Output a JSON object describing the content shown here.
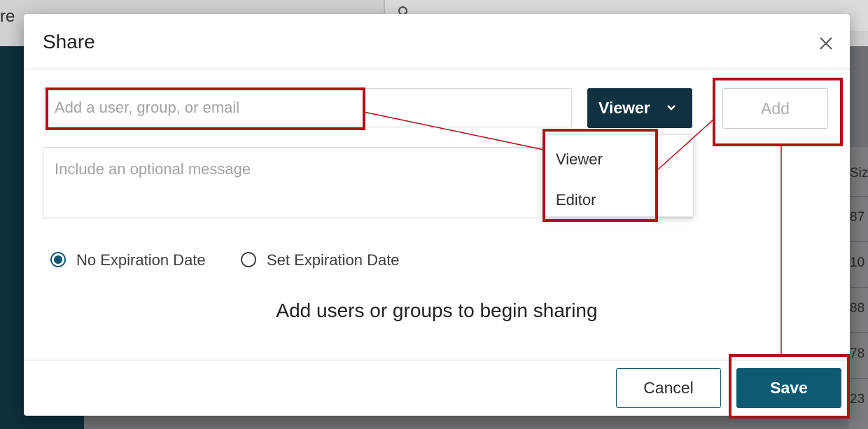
{
  "background": {
    "topbar_partial_text": "re",
    "table_partial_header": "Siz",
    "table_partial_cells": [
      "87",
      "10",
      "88",
      "78",
      "23"
    ]
  },
  "dialog": {
    "title": "Share",
    "user_input": {
      "placeholder": "Add a user, group, or email",
      "value": ""
    },
    "role_button": {
      "label": "Viewer"
    },
    "add_button": {
      "label": "Add",
      "disabled": true
    },
    "role_menu": {
      "items": [
        {
          "label": "Viewer"
        },
        {
          "label": "Editor"
        }
      ]
    },
    "message_input": {
      "placeholder": "Include an optional message",
      "value": ""
    },
    "expiration": {
      "options": [
        {
          "label": "No Expiration Date",
          "checked": true
        },
        {
          "label": "Set Expiration Date",
          "checked": false
        }
      ]
    },
    "empty_state": "Add users or groups to begin sharing",
    "footer": {
      "cancel_label": "Cancel",
      "save_label": "Save"
    }
  },
  "icons": {
    "close": "close-icon",
    "chevron": "chevron-down-icon",
    "search": "search-icon"
  },
  "colors": {
    "primary_dark": "#0f3242",
    "primary": "#0d5a73",
    "annotation_red": "#b30d18",
    "nav_dark": "#0e2f3e"
  }
}
